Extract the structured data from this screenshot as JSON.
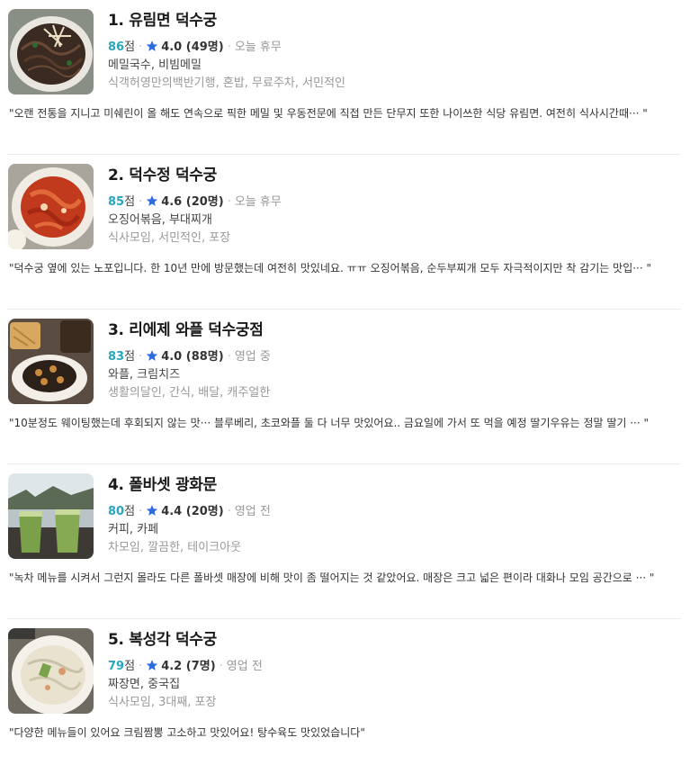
{
  "restaurants": [
    {
      "title": "1. 유림면 덕수궁",
      "score": "86",
      "score_unit": "점",
      "rating": "4.0 (49명)",
      "status": "오늘 휴무",
      "categories": "메밀국수, 비빔메밀",
      "tags": "식객허영만의백반기행, 혼밥, 무료주차, 서민적인",
      "review": "\"오랜 전통을 지니고 미쉐린이 올 해도 연속으로 픽한 메밀 및 우동전문에 직접 만든 단무지 또한 나이쓰한 식당 유림면. 여전히 식사시간때···  \"",
      "image": "buckwheat-noodles-photo"
    },
    {
      "title": "2. 덕수정 덕수궁",
      "score": "85",
      "score_unit": "점",
      "rating": "4.6 (20명)",
      "status": "오늘 휴무",
      "categories": "오징어볶음, 부대찌개",
      "tags": "식사모임, 서민적인, 포장",
      "review": "\"덕수궁 옆에 있는 노포입니다. 한 10년 만에 방문했는데 여전히 맛있네요. ㅠㅠ 오징어볶음, 순두부찌개 모두 자극적이지만 착 감기는 맛입··· \"",
      "image": "spicy-squid-photo"
    },
    {
      "title": "3. 리에제 와플 덕수궁점",
      "score": "83",
      "score_unit": "점",
      "rating": "4.0 (88명)",
      "status": "영업 중",
      "categories": "와플, 크림치즈",
      "tags": "생활의달인, 간식, 배달, 캐주얼한",
      "review": "\"10분정도 웨이팅했는데 후회되지 않는 맛··· 블루베리, 초코와플 둘 다 너무 맛있어요.. 금요일에 가서 또 먹을 예정 딸기우유는 정말 딸기 ···   \"",
      "image": "waffles-photo"
    },
    {
      "title": "4. 폴바셋 광화문",
      "score": "80",
      "score_unit": "점",
      "rating": "4.4 (20명)",
      "status": "영업 전",
      "categories": "커피, 카페",
      "tags": "차모임, 깔끔한, 테이크아웃",
      "review": "\"녹차 메뉴를 시켜서 그런지 몰라도 다른 폴바셋 매장에 비해 맛이 좀 떨어지는 것 같았어요. 매장은 크고 넓은 편이라 대화나 모임 공간으로 ··· \"",
      "image": "green-tea-drinks-photo"
    },
    {
      "title": "5. 복성각 덕수궁",
      "score": "79",
      "score_unit": "점",
      "rating": "4.2 (7명)",
      "status": "영업 전",
      "categories": "짜장면, 중국집",
      "tags": "식사모임, 3대째, 포장",
      "review": "\"다양한 메뉴들이 있어요 크림짬뽕 고소하고 맛있어요! 탕수육도 맛있었습니다\"",
      "image": "cream-jjamppong-photo"
    }
  ],
  "colors": {
    "score": "#28a6bd",
    "star": "#2c6be0",
    "muted": "#999999"
  }
}
